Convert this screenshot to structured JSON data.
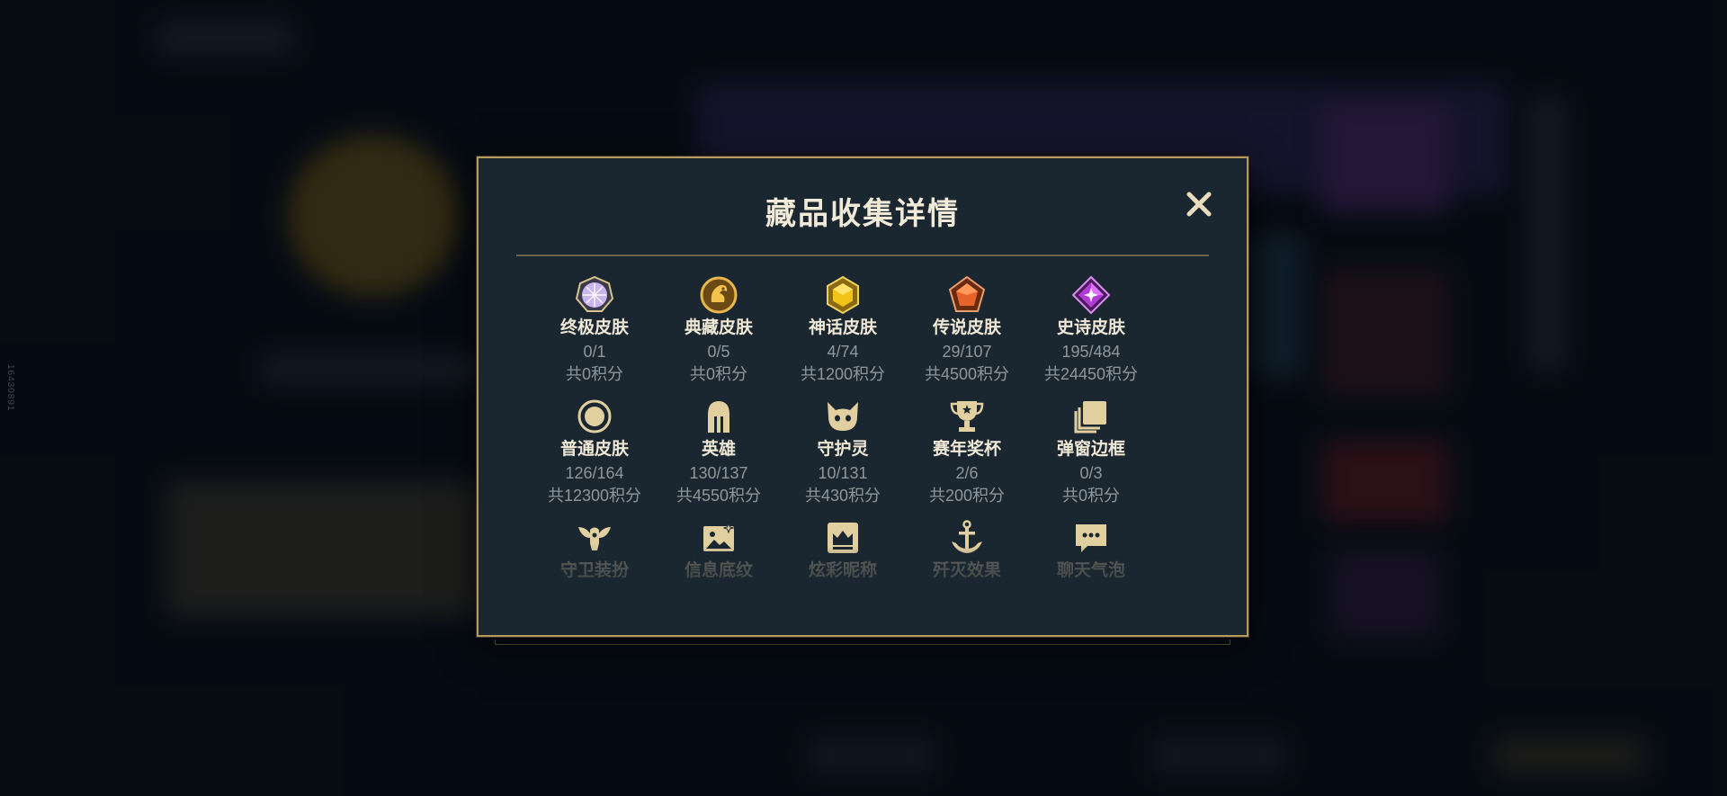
{
  "side_label": "16430891",
  "modal": {
    "title": "藏品收集详情",
    "close_icon": "close-icon"
  },
  "rows": [
    [
      {
        "name": "终极皮肤",
        "count": "0/1",
        "points": "共0积分",
        "icon": "ultimate-skin-icon"
      },
      {
        "name": "典藏皮肤",
        "count": "0/5",
        "points": "共0积分",
        "icon": "prestige-skin-icon"
      },
      {
        "name": "神话皮肤",
        "count": "4/74",
        "points": "共1200积分",
        "icon": "mythic-skin-icon"
      },
      {
        "name": "传说皮肤",
        "count": "29/107",
        "points": "共4500积分",
        "icon": "legendary-skin-icon"
      },
      {
        "name": "史诗皮肤",
        "count": "195/484",
        "points": "共24450积分",
        "icon": "epic-skin-icon"
      }
    ],
    [
      {
        "name": "普通皮肤",
        "count": "126/164",
        "points": "共12300积分",
        "icon": "common-skin-icon"
      },
      {
        "name": "英雄",
        "count": "130/137",
        "points": "共4550积分",
        "icon": "champion-helmet-icon"
      },
      {
        "name": "守护灵",
        "count": "10/131",
        "points": "共430积分",
        "icon": "guardian-spirit-icon"
      },
      {
        "name": "赛年奖杯",
        "count": "2/6",
        "points": "共200积分",
        "icon": "trophy-icon"
      },
      {
        "name": "弹窗边框",
        "count": "0/3",
        "points": "共0积分",
        "icon": "popup-frame-icon"
      }
    ],
    [
      {
        "name": "守卫装扮",
        "icon": "ward-skin-icon"
      },
      {
        "name": "信息底纹",
        "icon": "info-banner-icon"
      },
      {
        "name": "炫彩昵称",
        "icon": "crown-nameplate-icon"
      },
      {
        "name": "歼灭效果",
        "icon": "ace-effect-icon"
      },
      {
        "name": "聊天气泡",
        "icon": "chat-bubble-icon"
      }
    ]
  ],
  "colors": {
    "gold": "#b49a5c",
    "icon_gold": "#e2cfa0",
    "text_light": "#efe8d6",
    "text_dim": "#8f969c"
  }
}
